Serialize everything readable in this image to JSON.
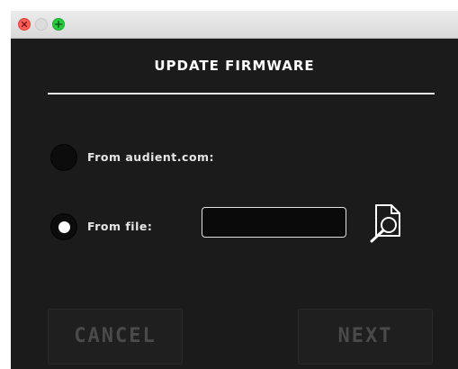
{
  "window": {
    "controls": {
      "close_icon": "close-icon",
      "minimize_icon": "minimize-icon",
      "zoom_icon": "zoom-icon"
    }
  },
  "dialog": {
    "title": "UPDATE FIRMWARE",
    "options": [
      {
        "label": "From audient.com:",
        "selected": false
      },
      {
        "label": "From file:",
        "selected": true
      }
    ],
    "file_path": {
      "value": "",
      "placeholder": ""
    },
    "browse_icon": "file-search-icon",
    "buttons": {
      "cancel": "CANCEL",
      "next": "NEXT"
    }
  },
  "colors": {
    "background": "#1b1b1b",
    "text": "#ffffff",
    "disabled_text": "#4a4a4a",
    "close": "#ff5f57",
    "zoom": "#28c940"
  }
}
